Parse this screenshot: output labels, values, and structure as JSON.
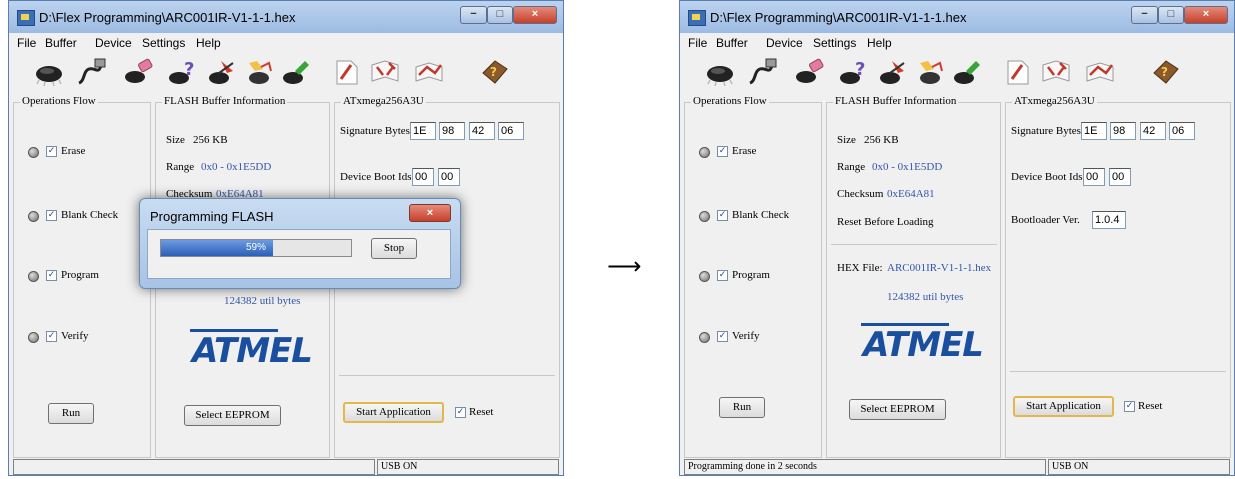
{
  "arrow": "⟶",
  "before": {
    "title": "D:\\Flex Programming\\ARC001IR-V1-1-1.hex",
    "menu": [
      "File",
      "Buffer",
      "Device",
      "Settings",
      "Help"
    ],
    "operations_flow": {
      "label": "Operations Flow",
      "items": [
        {
          "label": "Erase",
          "checked": true
        },
        {
          "label": "Blank Check",
          "checked": true
        },
        {
          "label": "Program",
          "checked": true
        },
        {
          "label": "Verify",
          "checked": true
        }
      ],
      "run_button": "Run"
    },
    "flash_buffer": {
      "label": "FLASH Buffer Information",
      "size_label": "Size",
      "size_value": "256 KB",
      "range_label": "Range",
      "range_value": "0x0 - 0x1E5DD",
      "checksum_label": "Checksum",
      "checksum_value": "0xE64A81",
      "util_bytes": "124382 util bytes",
      "logo": "ATMEL",
      "select_eeprom": "Select EEPROM"
    },
    "device": {
      "label": "ATxmega256A3U",
      "signature_label": "Signature Bytes",
      "signature": [
        "1E",
        "98",
        "42",
        "06"
      ],
      "boot_ids_label": "Device Boot Ids",
      "boot_ids": [
        "00",
        "00"
      ],
      "start_application": "Start Application",
      "reset_label": "Reset",
      "reset_checked": true
    },
    "status": {
      "left": "",
      "right": "USB ON"
    },
    "dialog": {
      "title": "Programming FLASH",
      "progress": 59,
      "progress_text": "59%",
      "stop_button": "Stop"
    }
  },
  "after": {
    "title": "D:\\Flex Programming\\ARC001IR-V1-1-1.hex",
    "menu": [
      "File",
      "Buffer",
      "Device",
      "Settings",
      "Help"
    ],
    "operations_flow": {
      "label": "Operations Flow",
      "items": [
        {
          "label": "Erase",
          "checked": true
        },
        {
          "label": "Blank Check",
          "checked": true
        },
        {
          "label": "Program",
          "checked": true
        },
        {
          "label": "Verify",
          "checked": true
        }
      ],
      "run_button": "Run"
    },
    "flash_buffer": {
      "label": "FLASH Buffer Information",
      "size_label": "Size",
      "size_value": "256 KB",
      "range_label": "Range",
      "range_value": "0x0 - 0x1E5DD",
      "checksum_label": "Checksum",
      "checksum_value": "0xE64A81",
      "reset_before_loading": "Reset Before Loading",
      "hex_file_label": "HEX File:",
      "hex_file_value": "ARC001IR-V1-1-1.hex",
      "util_bytes": "124382 util bytes",
      "logo": "ATMEL",
      "select_eeprom": "Select EEPROM"
    },
    "device": {
      "label": "ATxmega256A3U",
      "signature_label": "Signature Bytes",
      "signature": [
        "1E",
        "98",
        "42",
        "06"
      ],
      "boot_ids_label": "Device Boot Ids",
      "boot_ids": [
        "00",
        "00"
      ],
      "bootloader_label": "Bootloader Ver.",
      "bootloader_value": "1.0.4",
      "start_application": "Start Application",
      "reset_label": "Reset",
      "reset_checked": true
    },
    "status": {
      "left": "Programming done in 2 seconds",
      "right": "USB ON"
    }
  },
  "toolbar_icons": [
    "chip-icon",
    "usb-cable-icon",
    "erase-chip-icon",
    "blank-check-icon",
    "program-chip-icon",
    "verify-chip-icon",
    "auto-program-icon",
    "open-file-icon",
    "read-book-icon",
    "write-book-icon",
    "help-book-icon"
  ]
}
